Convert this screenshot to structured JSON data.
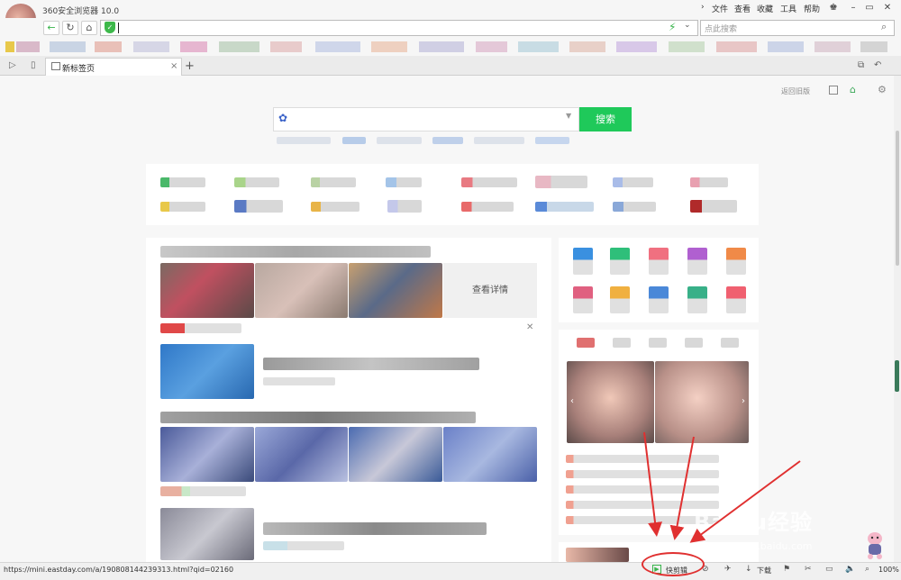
{
  "window": {
    "title": "360安全浏览器 10.0"
  },
  "menu": [
    "文件",
    "查看",
    "收藏",
    "工具",
    "帮助"
  ],
  "addressbar": {
    "placeholder": "点此搜索"
  },
  "tab": {
    "title": "新标签页"
  },
  "page": {
    "topright_link": "返回旧版",
    "search_button": "搜索",
    "detail_button": "查看详情"
  },
  "statusbar": {
    "url": "https://mini.eastday.com/a/190808144239313.html?qid=02160",
    "kuaijian": "快剪辑",
    "download": "下载",
    "zoom": "100%"
  },
  "colors": {
    "accent": "#1fc95a",
    "annotation": "#e03030"
  },
  "icons": [
    "back-icon",
    "refresh-icon",
    "home-icon",
    "shield-icon",
    "bolt-icon",
    "search-icon",
    "grid-icon",
    "gear-icon",
    "paw-icon",
    "close-icon",
    "play-icon",
    "download-icon",
    "speaker-icon"
  ]
}
